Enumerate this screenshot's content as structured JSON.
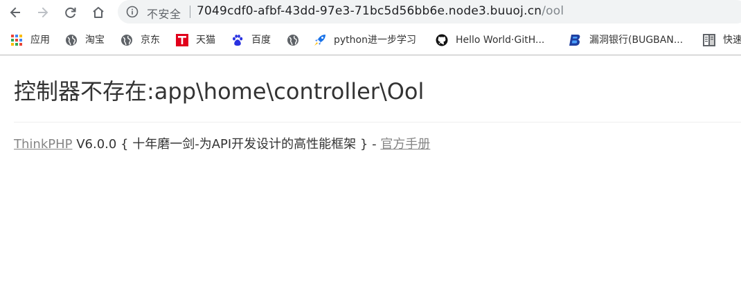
{
  "browser": {
    "security_label": "不安全",
    "url_host": "7049cdf0-afbf-43dd-97e3-71bc5d56bb6e.node3.buuoj.cn",
    "url_path": "/ool"
  },
  "bookmarks": [
    {
      "label": "应用",
      "icon": "apps-grid-icon"
    },
    {
      "label": "淘宝",
      "icon": "globe-icon"
    },
    {
      "label": "京东",
      "icon": "globe-icon"
    },
    {
      "label": "天猫",
      "icon": "tmall-icon"
    },
    {
      "label": "百度",
      "icon": "baidu-paw-icon"
    },
    {
      "label": "",
      "icon": "globe-icon"
    },
    {
      "label": "python进一步学习",
      "icon": "rocket-icon"
    },
    {
      "label": "Hello World·GitH...",
      "icon": "github-icon"
    },
    {
      "label": "漏洞银行(BUGBAN...",
      "icon": "bugbank-icon"
    },
    {
      "label": "快速",
      "icon": "bookmark-page-icon"
    }
  ],
  "page": {
    "error_title": "控制器不存在:app\\home\\controller\\Ool",
    "footer_link_thinkphp": "ThinkPHP",
    "footer_text": " V6.0.0 { 十年磨一剑-为API开发设计的高性能框架 } - ",
    "footer_link_manual": "官方手册"
  }
}
